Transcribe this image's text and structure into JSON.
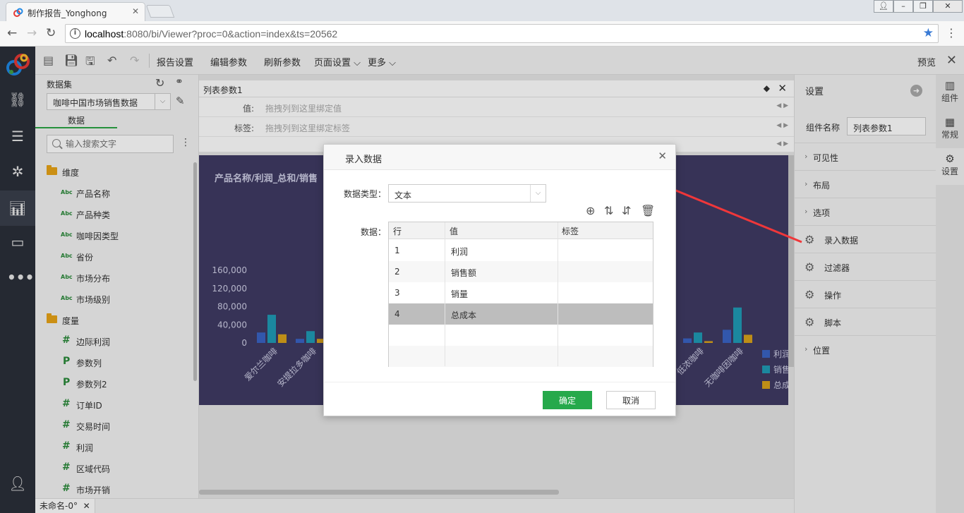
{
  "browser": {
    "tab_title": "制作报告_Yonghong",
    "url_host": "localhost",
    "url_rest": ":8080/bi/Viewer?proc=0&action=index&ts=20562"
  },
  "toolbar": {
    "items": [
      "报告设置",
      "编辑参数",
      "刷新参数",
      "页面设置 ⌵",
      "更多 ⌵"
    ],
    "preview": "预览"
  },
  "datapanel": {
    "title": "数据集",
    "dataset": "咖啡中国市场销售数据",
    "tab": "数据",
    "search_placeholder": "输入搜索文字",
    "tree": [
      {
        "type": "folder",
        "label": "维度"
      },
      {
        "type": "abc",
        "label": "产品名称"
      },
      {
        "type": "abc",
        "label": "产品种类"
      },
      {
        "type": "abc",
        "label": "咖啡因类型"
      },
      {
        "type": "abc",
        "label": "省份"
      },
      {
        "type": "abc",
        "label": "市场分布"
      },
      {
        "type": "abc",
        "label": "市场级别"
      },
      {
        "type": "folder",
        "label": "度量"
      },
      {
        "type": "hash",
        "label": "边际利润"
      },
      {
        "type": "p",
        "label": "参数列"
      },
      {
        "type": "p",
        "label": "参数列2"
      },
      {
        "type": "hash",
        "label": "订单ID"
      },
      {
        "type": "hash",
        "label": "交易时间"
      },
      {
        "type": "hash",
        "label": "利润"
      },
      {
        "type": "hash",
        "label": "区域代码"
      },
      {
        "type": "hash",
        "label": "市场开销"
      }
    ]
  },
  "listparam": {
    "title": "列表参数1",
    "value_label": "值:",
    "value_hint": "拖拽列到这里绑定值",
    "tag_label": "标签:",
    "tag_hint": "拖拽列到这里绑定标签"
  },
  "chart_data": {
    "type": "bar",
    "title": "产品名称/利润_总和/销售",
    "ylim": [
      0,
      160000
    ],
    "yticks": [
      "0",
      "40,000",
      "80,000",
      "120,000",
      "160,000"
    ],
    "categories": [
      "爱尔兰咖啡",
      "安提拉多咖啡",
      "低浓咖啡",
      "无咖啡因咖啡"
    ],
    "series": [
      {
        "name": "利润",
        "color": "#3a63c4",
        "values": [
          23000,
          9000,
          10000,
          29000
        ]
      },
      {
        "name": "销售额",
        "color": "#1f9bb5",
        "values": [
          62000,
          26000,
          23000,
          78000
        ]
      },
      {
        "name": "总成本",
        "color": "#d9a21b",
        "values": [
          19000,
          9000,
          4000,
          18000
        ]
      }
    ],
    "legend_labels": [
      "利润",
      "销售",
      "总成"
    ]
  },
  "settings": {
    "title": "设置",
    "name_label": "组件名称",
    "name_value": "列表参数1",
    "rows": [
      {
        "kind": "chev",
        "label": "可见性"
      },
      {
        "kind": "chev",
        "label": "布局"
      },
      {
        "kind": "chev",
        "label": "选项"
      },
      {
        "kind": "gear",
        "label": "录入数据"
      },
      {
        "kind": "gear",
        "label": "过滤器"
      },
      {
        "kind": "gear",
        "label": "操作"
      },
      {
        "kind": "gear",
        "label": "脚本"
      },
      {
        "kind": "chev",
        "label": "位置"
      }
    ],
    "side_tabs": [
      "组件",
      "常规",
      "设置"
    ]
  },
  "status": {
    "tab": "未命名-0°"
  },
  "modal": {
    "title": "录入数据",
    "type_label": "数据类型：",
    "type_value": "文本",
    "data_label": "数据：",
    "columns": [
      "行",
      "值",
      "标签"
    ],
    "rows": [
      {
        "row": "1",
        "value": "利润",
        "tag": ""
      },
      {
        "row": "2",
        "value": "销售额",
        "tag": ""
      },
      {
        "row": "3",
        "value": "销量",
        "tag": ""
      },
      {
        "row": "4",
        "value": "总成本",
        "tag": ""
      },
      {
        "row": "",
        "value": "",
        "tag": ""
      },
      {
        "row": "",
        "value": "",
        "tag": ""
      }
    ],
    "selected_row": 3,
    "ok": "确定",
    "cancel": "取消"
  }
}
